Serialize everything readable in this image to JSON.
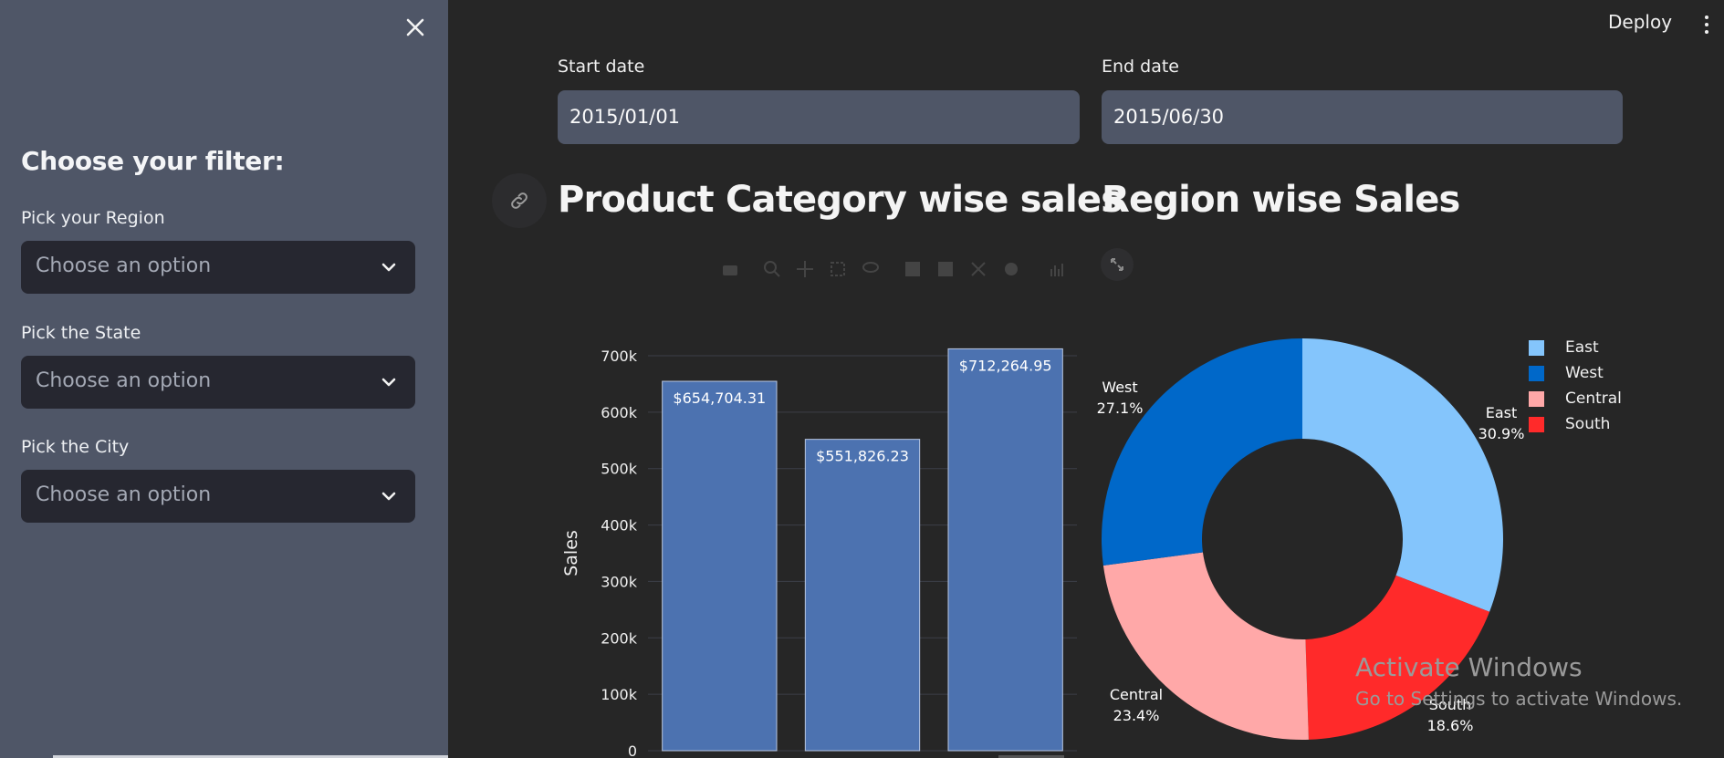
{
  "sidebar": {
    "heading": "Choose your filter:",
    "filters": [
      {
        "label": "Pick your Region",
        "placeholder": "Choose an option"
      },
      {
        "label": "Pick the State",
        "placeholder": "Choose an option"
      },
      {
        "label": "Pick the City",
        "placeholder": "Choose an option"
      }
    ]
  },
  "header": {
    "deploy_label": "Deploy"
  },
  "dates": {
    "start": {
      "label": "Start date",
      "value": "2015/01/01"
    },
    "end": {
      "label": "End date",
      "value": "2015/06/30"
    }
  },
  "sections": {
    "left_title": "Product Category wise sales",
    "right_title": "Region wise Sales"
  },
  "chart_data": [
    {
      "type": "bar",
      "title": "Product Category wise sales",
      "xlabel": "",
      "ylabel": "Sales",
      "categories": [
        "",
        "",
        ""
      ],
      "values": [
        654704.31,
        551826.23,
        712264.95
      ],
      "data_labels": [
        "$654,704.31",
        "$551,826.23",
        "$712,264.95"
      ],
      "yticks": [
        "0",
        "100k",
        "200k",
        "300k",
        "400k",
        "500k",
        "600k",
        "700k"
      ],
      "ylim": [
        0,
        700000
      ],
      "grid": true,
      "color": "#4c72b0"
    },
    {
      "type": "pie",
      "title": "Region wise Sales",
      "hole": 0.5,
      "slices": [
        {
          "label": "East",
          "percent_label": "30.9%",
          "value": 30.9,
          "color": "#84c5fc"
        },
        {
          "label": "South",
          "percent_label": "18.6%",
          "value": 18.6,
          "color": "#ff2a2a"
        },
        {
          "label": "Central",
          "percent_label": "23.4%",
          "value": 23.4,
          "color": "#ffa8a8"
        },
        {
          "label": "West",
          "percent_label": "27.1%",
          "value": 27.1,
          "color": "#0068c9"
        }
      ],
      "legend": [
        "East",
        "West",
        "Central",
        "South"
      ],
      "legend_placement": "top-right"
    }
  ],
  "watermark": {
    "line1": "Activate Windows",
    "line2": "Go to Settings to activate Windows."
  }
}
